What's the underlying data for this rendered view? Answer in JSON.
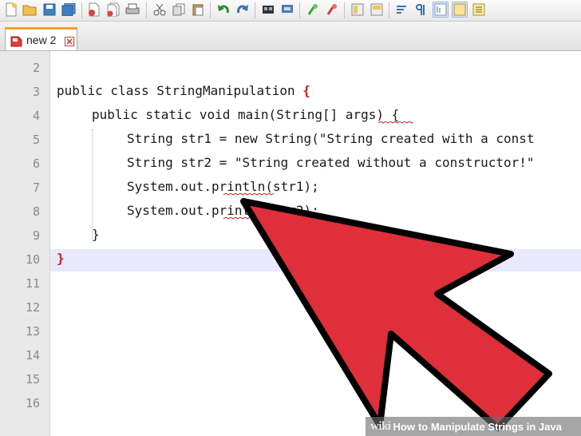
{
  "toolbar": {
    "buttons": [
      "new-file-icon",
      "open-file-icon",
      "save-icon",
      "save-all-icon",
      "close-icon",
      "close-all-icon",
      "print-icon",
      "cut-icon",
      "copy-icon",
      "paste-icon",
      "undo-icon",
      "redo-icon",
      "find-icon",
      "replace-icon",
      "zoom-in-icon",
      "zoom-out-icon",
      "sync-vertical-icon",
      "sync-horizontal-icon",
      "word-wrap-icon",
      "show-all-chars-icon",
      "indent-guide-icon",
      "doc-map-icon",
      "function-list-icon"
    ]
  },
  "tabs": [
    {
      "label": "new 2",
      "active": true
    }
  ],
  "editor": {
    "line_numbers": [
      "2",
      "3",
      "4",
      "5",
      "6",
      "7",
      "8",
      "9",
      "10",
      "11",
      "12",
      "13",
      "14",
      "15",
      "16"
    ],
    "current_line": "10",
    "lines": {
      "l3_a": "public class StringManipulation ",
      "l3_b": "{",
      "l4": "public static void main(String[] args) {",
      "l5": "String str1 = new String(\"String created with a const",
      "l6": "String str2 = \"String created without a constructor!\"",
      "l7": "System.out.println(str1);",
      "l8": "System.out.println(str2);",
      "l9": "}",
      "l10": "}"
    }
  },
  "watermark": {
    "logo": "wiki",
    "how": "How",
    "text": "to Manipulate Strings in Java"
  },
  "colors": {
    "arrow": "#de2f3b",
    "brace": "#e01818",
    "current_line": "#e8e8ff",
    "gutter": "#e8e8e8"
  }
}
